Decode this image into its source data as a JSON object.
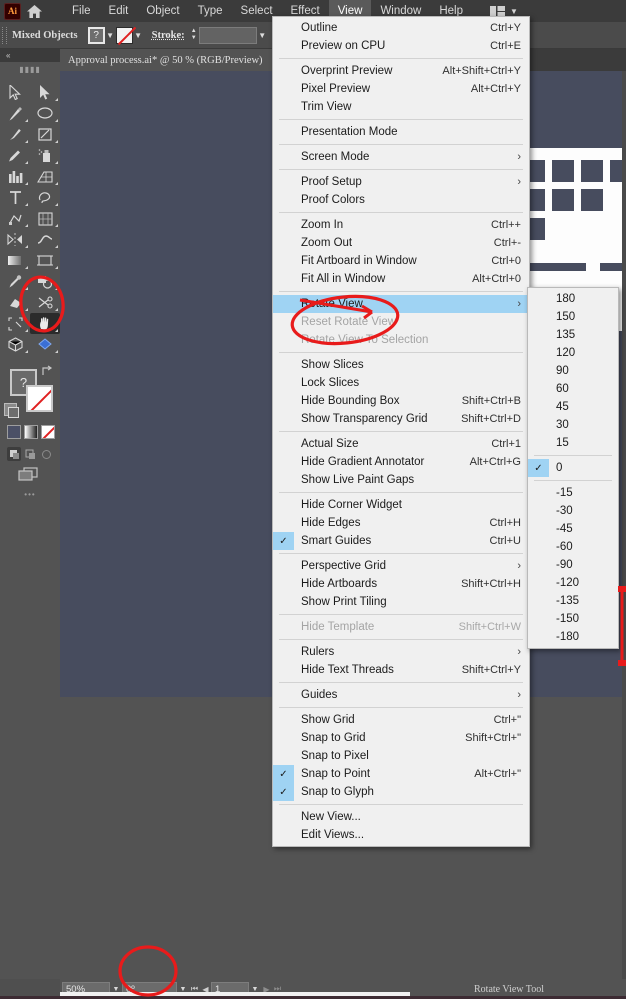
{
  "app": {
    "logo_text": "Ai",
    "home_icon": "home-icon",
    "doc_arrange_icon": "document-arrange-icon"
  },
  "menubar": {
    "items": [
      {
        "label": "File",
        "active": false
      },
      {
        "label": "Edit",
        "active": false
      },
      {
        "label": "Object",
        "active": false
      },
      {
        "label": "Type",
        "active": false
      },
      {
        "label": "Select",
        "active": false
      },
      {
        "label": "Effect",
        "active": false
      },
      {
        "label": "View",
        "active": true
      },
      {
        "label": "Window",
        "active": false
      },
      {
        "label": "Help",
        "active": false
      }
    ]
  },
  "controlbar": {
    "selection_label": "Mixed Objects",
    "fill_value": "?",
    "stroke_label": "Stroke:",
    "stroke_value": "",
    "align_icons": [
      "align-horizontal-left-icon",
      "align-horizontal-center-icon",
      "align-horizontal-right-icon",
      "align-vertical-top-icon",
      "align-vertical-center-icon"
    ]
  },
  "tab": {
    "title": "Approval process.ai* @ 50 % (RGB/Preview)",
    "close_label": "×"
  },
  "toolbox": {
    "tools": [
      {
        "name": "selection-tool",
        "selected": false
      },
      {
        "name": "direct-selection-tool",
        "selected": false
      },
      {
        "name": "pen-tool",
        "selected": false
      },
      {
        "name": "ellipse-tool",
        "selected": false
      },
      {
        "name": "paintbrush-tool",
        "selected": false
      },
      {
        "name": "shaper-tool",
        "selected": false
      },
      {
        "name": "pencil-tool",
        "selected": false
      },
      {
        "name": "spray-symbol-tool",
        "selected": false
      },
      {
        "name": "column-graph-tool",
        "selected": false
      },
      {
        "name": "perspective-grid-tool",
        "selected": false
      },
      {
        "name": "type-tool",
        "selected": false
      },
      {
        "name": "lasso-tool",
        "selected": false
      },
      {
        "name": "gradient-mesh-tool",
        "selected": false
      },
      {
        "name": "live-paint-tool",
        "selected": false
      },
      {
        "name": "reflect-tool",
        "selected": false
      },
      {
        "name": "width-tool",
        "selected": false
      },
      {
        "name": "gradient-tool",
        "selected": false
      },
      {
        "name": "artboard-tool",
        "selected": false
      },
      {
        "name": "eyedropper-tool",
        "selected": false
      },
      {
        "name": "blend-tool",
        "selected": false
      },
      {
        "name": "eraser-tool",
        "selected": false
      },
      {
        "name": "scissors-tool",
        "selected": false
      },
      {
        "name": "slice-tool",
        "selected": false
      },
      {
        "name": "rotate-view-tool",
        "selected": true
      },
      {
        "name": "3d-tool",
        "selected": false
      },
      {
        "name": "symbol-tool",
        "selected": false
      }
    ],
    "more_tools_label": "•••",
    "fill_swatch_value": "?",
    "stroke_swatch": "none-swatch",
    "color_modes": [
      "color-swatch",
      "gradient-swatch",
      "none-swatch"
    ],
    "draw_modes": [
      "draw-normal",
      "draw-behind",
      "draw-inside"
    ],
    "screen_mode_icon": "screen-mode-icon"
  },
  "menu": {
    "title": "View",
    "groups": [
      {
        "items": [
          {
            "label": "Outline",
            "shortcut": "Ctrl+Y",
            "disabled": false,
            "checked": false,
            "submenu": false,
            "highlighted": false
          },
          {
            "label": "Preview on CPU",
            "shortcut": "Ctrl+E",
            "disabled": false,
            "checked": false,
            "submenu": false,
            "highlighted": false
          }
        ]
      },
      {
        "items": [
          {
            "label": "Overprint Preview",
            "shortcut": "Alt+Shift+Ctrl+Y",
            "disabled": false,
            "checked": false,
            "submenu": false,
            "highlighted": false
          },
          {
            "label": "Pixel Preview",
            "shortcut": "Alt+Ctrl+Y",
            "disabled": false,
            "checked": false,
            "submenu": false,
            "highlighted": false
          },
          {
            "label": "Trim View",
            "shortcut": "",
            "disabled": false,
            "checked": false,
            "submenu": false,
            "highlighted": false
          }
        ]
      },
      {
        "items": [
          {
            "label": "Presentation Mode",
            "shortcut": "",
            "disabled": false,
            "checked": false,
            "submenu": false,
            "highlighted": false
          }
        ]
      },
      {
        "items": [
          {
            "label": "Screen Mode",
            "shortcut": "",
            "disabled": false,
            "checked": false,
            "submenu": true,
            "highlighted": false
          }
        ]
      },
      {
        "items": [
          {
            "label": "Proof Setup",
            "shortcut": "",
            "disabled": false,
            "checked": false,
            "submenu": true,
            "highlighted": false
          },
          {
            "label": "Proof Colors",
            "shortcut": "",
            "disabled": false,
            "checked": false,
            "submenu": false,
            "highlighted": false
          }
        ]
      },
      {
        "items": [
          {
            "label": "Zoom In",
            "shortcut": "Ctrl++",
            "disabled": false,
            "checked": false,
            "submenu": false,
            "highlighted": false
          },
          {
            "label": "Zoom Out",
            "shortcut": "Ctrl+-",
            "disabled": false,
            "checked": false,
            "submenu": false,
            "highlighted": false
          },
          {
            "label": "Fit Artboard in Window",
            "shortcut": "Ctrl+0",
            "disabled": false,
            "checked": false,
            "submenu": false,
            "highlighted": false
          },
          {
            "label": "Fit All in Window",
            "shortcut": "Alt+Ctrl+0",
            "disabled": false,
            "checked": false,
            "submenu": false,
            "highlighted": false
          }
        ]
      },
      {
        "items": [
          {
            "label": "Rotate View",
            "shortcut": "",
            "disabled": false,
            "checked": false,
            "submenu": true,
            "highlighted": true
          },
          {
            "label": "Reset Rotate View",
            "shortcut": "",
            "disabled": true,
            "checked": false,
            "submenu": false,
            "highlighted": false
          },
          {
            "label": "Rotate View To Selection",
            "shortcut": "",
            "disabled": true,
            "checked": false,
            "submenu": false,
            "highlighted": false
          }
        ]
      },
      {
        "items": [
          {
            "label": "Show Slices",
            "shortcut": "",
            "disabled": false,
            "checked": false,
            "submenu": false,
            "highlighted": false
          },
          {
            "label": "Lock Slices",
            "shortcut": "",
            "disabled": false,
            "checked": false,
            "submenu": false,
            "highlighted": false
          },
          {
            "label": "Hide Bounding Box",
            "shortcut": "Shift+Ctrl+B",
            "disabled": false,
            "checked": false,
            "submenu": false,
            "highlighted": false
          },
          {
            "label": "Show Transparency Grid",
            "shortcut": "Shift+Ctrl+D",
            "disabled": false,
            "checked": false,
            "submenu": false,
            "highlighted": false
          }
        ]
      },
      {
        "items": [
          {
            "label": "Actual Size",
            "shortcut": "Ctrl+1",
            "disabled": false,
            "checked": false,
            "submenu": false,
            "highlighted": false
          },
          {
            "label": "Hide Gradient Annotator",
            "shortcut": "Alt+Ctrl+G",
            "disabled": false,
            "checked": false,
            "submenu": false,
            "highlighted": false
          },
          {
            "label": "Show Live Paint Gaps",
            "shortcut": "",
            "disabled": false,
            "checked": false,
            "submenu": false,
            "highlighted": false
          }
        ]
      },
      {
        "items": [
          {
            "label": "Hide Corner Widget",
            "shortcut": "",
            "disabled": false,
            "checked": false,
            "submenu": false,
            "highlighted": false
          },
          {
            "label": "Hide Edges",
            "shortcut": "Ctrl+H",
            "disabled": false,
            "checked": false,
            "submenu": false,
            "highlighted": false
          },
          {
            "label": "Smart Guides",
            "shortcut": "Ctrl+U",
            "disabled": false,
            "checked": true,
            "submenu": false,
            "highlighted": false
          }
        ]
      },
      {
        "items": [
          {
            "label": "Perspective Grid",
            "shortcut": "",
            "disabled": false,
            "checked": false,
            "submenu": true,
            "highlighted": false
          },
          {
            "label": "Hide Artboards",
            "shortcut": "Shift+Ctrl+H",
            "disabled": false,
            "checked": false,
            "submenu": false,
            "highlighted": false
          },
          {
            "label": "Show Print Tiling",
            "shortcut": "",
            "disabled": false,
            "checked": false,
            "submenu": false,
            "highlighted": false
          }
        ]
      },
      {
        "items": [
          {
            "label": "Hide Template",
            "shortcut": "Shift+Ctrl+W",
            "disabled": true,
            "checked": false,
            "submenu": false,
            "highlighted": false
          }
        ]
      },
      {
        "items": [
          {
            "label": "Rulers",
            "shortcut": "",
            "disabled": false,
            "checked": false,
            "submenu": true,
            "highlighted": false
          },
          {
            "label": "Hide Text Threads",
            "shortcut": "Shift+Ctrl+Y",
            "disabled": false,
            "checked": false,
            "submenu": false,
            "highlighted": false
          }
        ]
      },
      {
        "items": [
          {
            "label": "Guides",
            "shortcut": "",
            "disabled": false,
            "checked": false,
            "submenu": true,
            "highlighted": false
          }
        ]
      },
      {
        "items": [
          {
            "label": "Show Grid",
            "shortcut": "Ctrl+\"",
            "disabled": false,
            "checked": false,
            "submenu": false,
            "highlighted": false
          },
          {
            "label": "Snap to Grid",
            "shortcut": "Shift+Ctrl+\"",
            "disabled": false,
            "checked": false,
            "submenu": false,
            "highlighted": false
          },
          {
            "label": "Snap to Pixel",
            "shortcut": "",
            "disabled": false,
            "checked": false,
            "submenu": false,
            "highlighted": false
          },
          {
            "label": "Snap to Point",
            "shortcut": "Alt+Ctrl+\"",
            "disabled": false,
            "checked": true,
            "submenu": false,
            "highlighted": false
          },
          {
            "label": "Snap to Glyph",
            "shortcut": "",
            "disabled": false,
            "checked": true,
            "submenu": false,
            "highlighted": false
          }
        ]
      },
      {
        "items": [
          {
            "label": "New View...",
            "shortcut": "",
            "disabled": false,
            "checked": false,
            "submenu": false,
            "highlighted": false
          },
          {
            "label": "Edit Views...",
            "shortcut": "",
            "disabled": false,
            "checked": false,
            "submenu": false,
            "highlighted": false
          }
        ]
      }
    ]
  },
  "submenu": {
    "name": "rotate-view-angles",
    "groups": [
      {
        "items": [
          {
            "label": "180",
            "checked": false
          },
          {
            "label": "150",
            "checked": false
          },
          {
            "label": "135",
            "checked": false
          },
          {
            "label": "120",
            "checked": false
          },
          {
            "label": "90",
            "checked": false
          },
          {
            "label": "60",
            "checked": false
          },
          {
            "label": "45",
            "checked": false
          },
          {
            "label": "30",
            "checked": false
          },
          {
            "label": "15",
            "checked": false
          }
        ]
      },
      {
        "items": [
          {
            "label": "0",
            "checked": true
          }
        ]
      },
      {
        "items": [
          {
            "label": "-15",
            "checked": false
          },
          {
            "label": "-30",
            "checked": false
          },
          {
            "label": "-45",
            "checked": false
          },
          {
            "label": "-60",
            "checked": false
          },
          {
            "label": "-90",
            "checked": false
          },
          {
            "label": "-120",
            "checked": false
          },
          {
            "label": "-135",
            "checked": false
          },
          {
            "label": "-150",
            "checked": false
          },
          {
            "label": "-180",
            "checked": false
          }
        ]
      }
    ]
  },
  "statusbar": {
    "zoom_value": "50%",
    "rotate_value": "0º",
    "page_value": "1",
    "tool_label": "Rotate View Tool",
    "nav_first": "⏮",
    "nav_prev": "◀",
    "nav_next": "▶",
    "nav_last": "⏭"
  },
  "annotations": {
    "accent_color": "#e81b1b",
    "marks": [
      {
        "name": "annotation-circle-rotate-view-tool"
      },
      {
        "name": "annotation-circle-reset-rotate-view"
      },
      {
        "name": "annotation-circle-rotate-angle-field"
      },
      {
        "name": "annotation-line-right-edge"
      }
    ]
  }
}
